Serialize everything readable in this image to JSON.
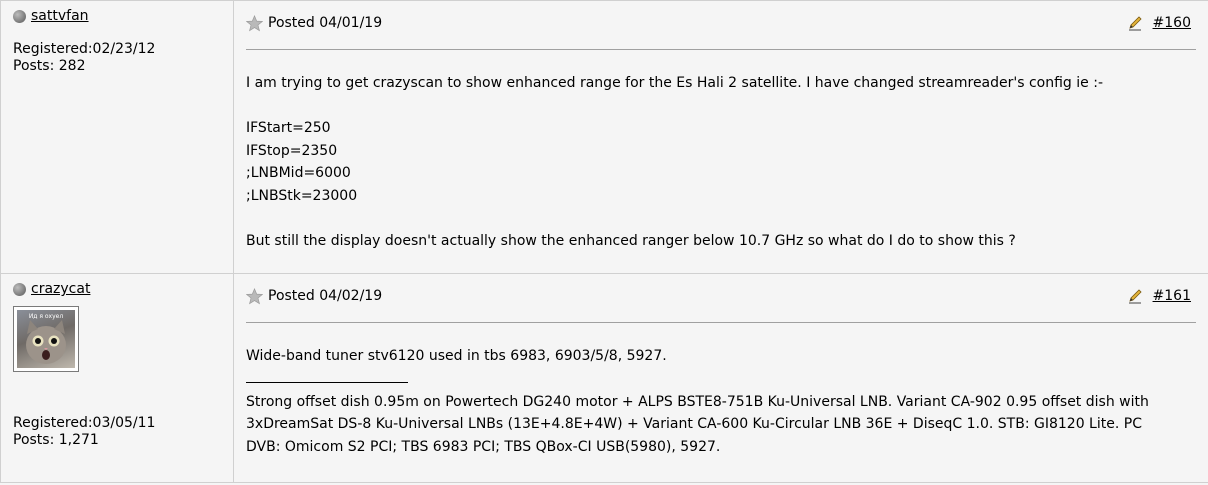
{
  "posts": [
    {
      "username": "sattvfan",
      "registered": "Registered:02/23/12",
      "posts_count": "Posts: 282",
      "posted": "Posted 04/01/19",
      "post_number": "#160",
      "body": [
        "I am trying to get crazyscan to show enhanced range for the Es Hali 2 satellite. I have changed streamreader's config ie :-",
        "IFStart=250",
        "IFStop=2350",
        ";LNBMid=6000",
        ";LNBStk=23000",
        "But still the display doesn't actually show the enhanced ranger below 10.7 GHz so what do I do to show this ?"
      ]
    },
    {
      "username": "crazycat",
      "avatar_caption": "Ид я охуел",
      "registered": "Registered:03/05/11",
      "posts_count": "Posts: 1,271",
      "posted": "Posted 04/02/19",
      "post_number": "#161",
      "body": [
        "Wide-band tuner stv6120 used in tbs 6983, 6903/5/8, 5927."
      ],
      "signature": [
        "Strong offset dish 0.95m on Powertech DG240 motor + ALPS BSTE8-751B Ku-Universal LNB. Variant CA-902 0.95 offset dish with",
        "3xDreamSat DS-8 Ku-Universal LNBs (13E+4.8E+4W) + Variant CA-600 Ku-Circular LNB 36E + DiseqC 1.0. STB: GI8120 Lite. PC",
        "DVB: Omicom S2 PCI; TBS 6983 PCI; TBS QBox-CI USB(5980), 5927."
      ]
    }
  ],
  "icons": {
    "status": "status-dot-icon",
    "star": "star-icon",
    "pencil": "pencil-icon"
  }
}
